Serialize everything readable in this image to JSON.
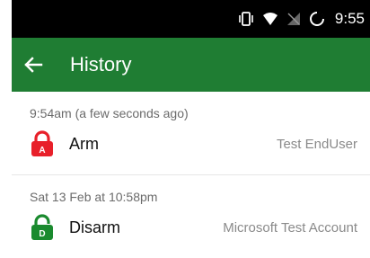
{
  "status_bar": {
    "time": "9:55",
    "icons": [
      "vibrate-icon",
      "wifi-icon",
      "no-signal-icon",
      "sync-icon"
    ]
  },
  "app_bar": {
    "title": "History",
    "back_icon": "arrow-left-icon",
    "color": "#1f7d33"
  },
  "history": [
    {
      "time": "9:54am (a few seconds ago)",
      "action": "Arm",
      "badge": "A",
      "icon": "lock-closed-icon",
      "icon_color": "#e8202a",
      "user": "Test EndUser"
    },
    {
      "time": "Sat 13 Feb at 10:58pm",
      "action": "Disarm",
      "badge": "D",
      "icon": "lock-open-icon",
      "icon_color": "#1a8a2e",
      "user": "Microsoft Test Account"
    }
  ]
}
